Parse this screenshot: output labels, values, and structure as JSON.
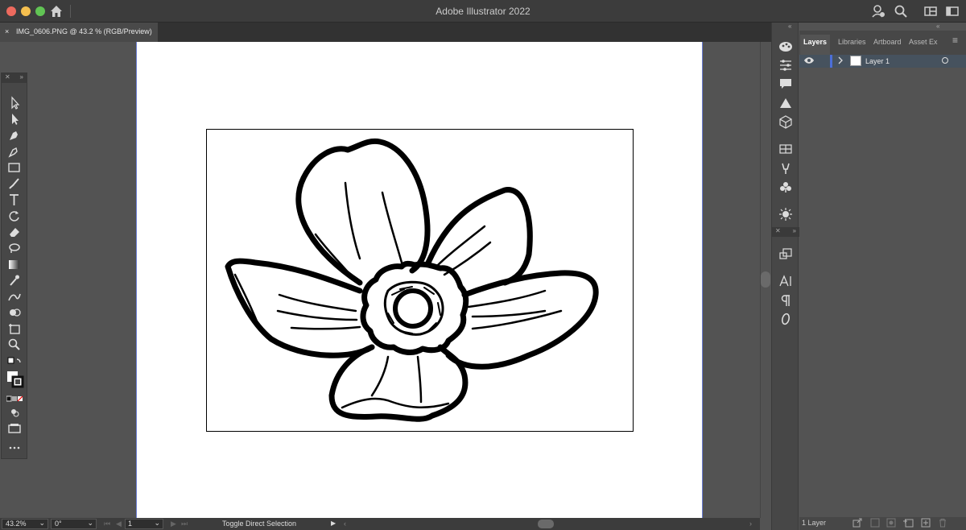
{
  "window": {
    "title": "Adobe Illustrator 2022"
  },
  "document_tab": {
    "close": "×",
    "label": "IMG_0606.PNG @ 43.2 % (RGB/Preview)"
  },
  "layers_panel": {
    "tabs": [
      "Layers",
      "Libraries",
      "Artboard",
      "Asset Ex"
    ],
    "active_tab": "Layers",
    "layers": [
      {
        "name": "Layer 1",
        "visible": true
      }
    ],
    "footer_count": "1 Layer"
  },
  "statusbar": {
    "zoom": "43.2%",
    "rotation": "0°",
    "artboard_number": "1",
    "tool_hint": "Toggle Direct Selection"
  },
  "colors": {
    "accent": "#6b7ed3",
    "selected_row": "#46525e",
    "panel_bg": "#474747",
    "canvas_bg": "#535353"
  },
  "icons": {
    "toolbar": [
      "selection-tool-icon",
      "direct-selection-tool-icon",
      "pen-tool-icon",
      "curvature-tool-icon",
      "rectangle-tool-icon",
      "paintbrush-tool-icon",
      "type-tool-icon",
      "rotate-tool-icon",
      "eraser-tool-icon",
      "lasso-tool-icon",
      "gradient-tool-icon",
      "eyedropper-tool-icon",
      "blend-tool-icon",
      "shape-builder-tool-icon",
      "artboard-tool-icon",
      "zoom-tool-icon",
      "fill-stroke-icon",
      "draw-mode-icon",
      "screen-mode-icon",
      "more-tools-icon"
    ]
  }
}
